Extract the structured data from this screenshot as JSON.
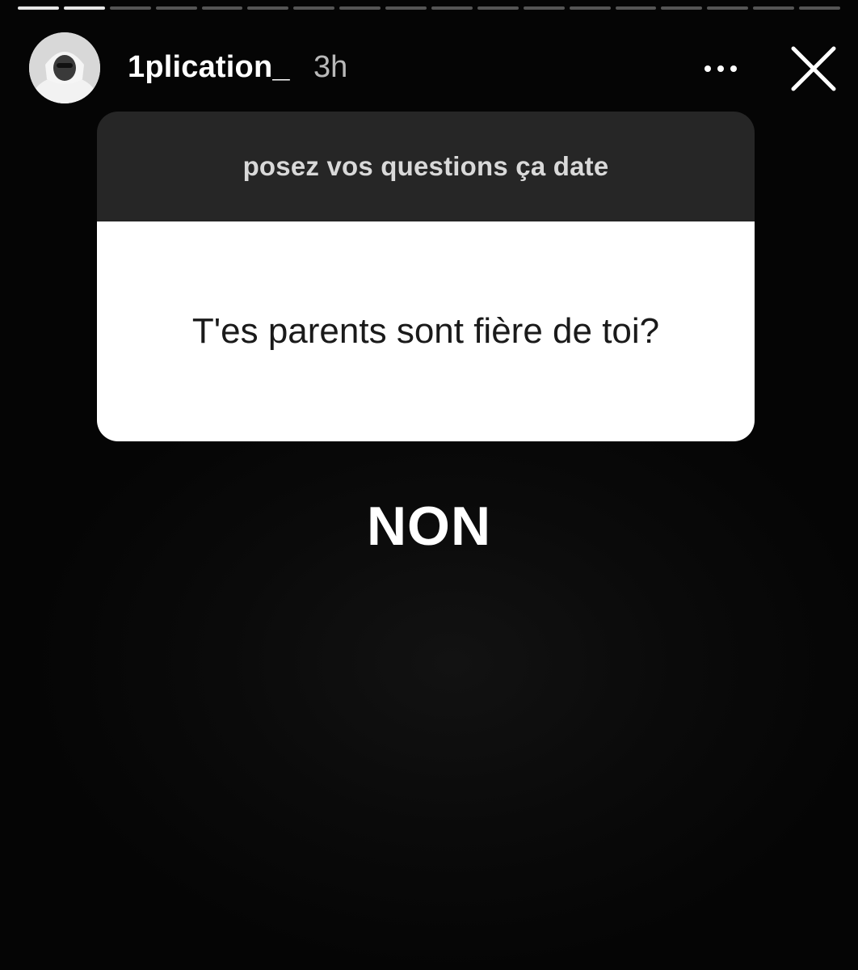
{
  "story": {
    "progress_segments": 18,
    "seen_segments": 2
  },
  "header": {
    "username": "1plication_",
    "timestamp": "3h",
    "more_icon": "more-horizontal-icon",
    "close_icon": "close-icon"
  },
  "question_sticker": {
    "prompt": "posez vos questions ça date",
    "question": "T'es parents sont fière de toi?"
  },
  "answer": {
    "text": "NON"
  },
  "colors": {
    "background": "#000000",
    "sticker_header": "#262626",
    "sticker_body": "#ffffff",
    "text_primary": "#ffffff"
  }
}
